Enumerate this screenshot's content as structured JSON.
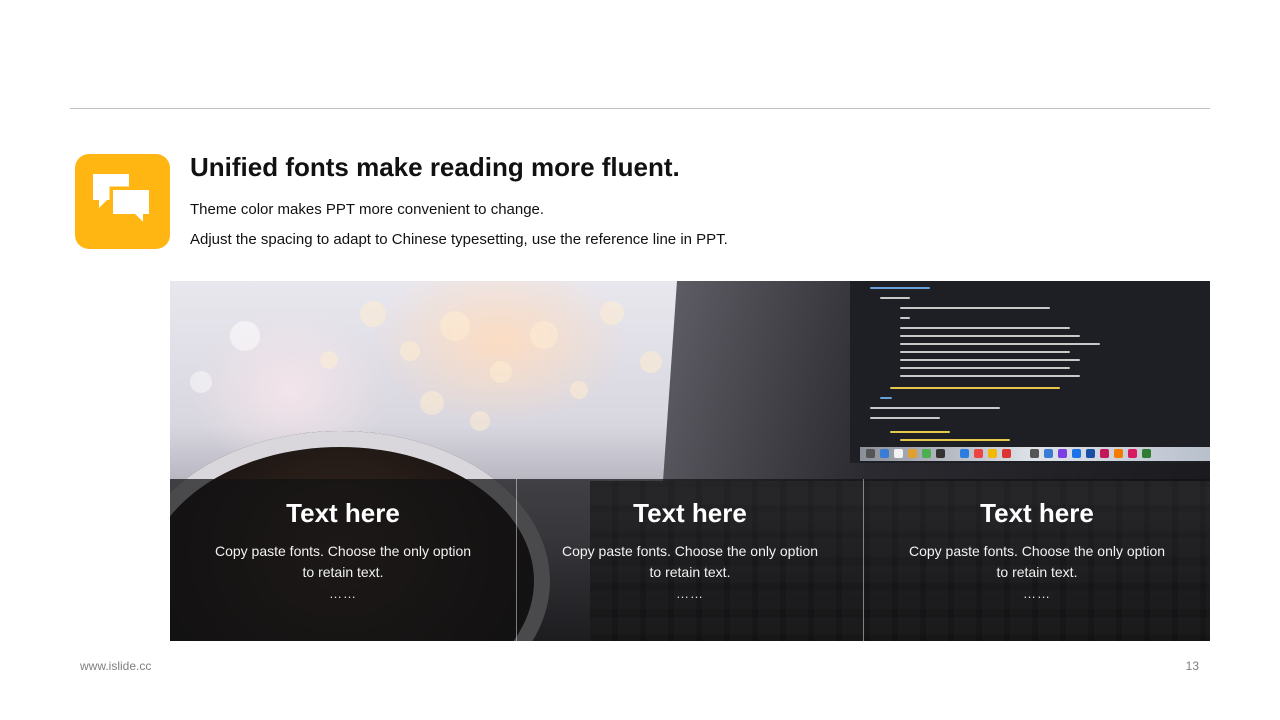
{
  "slide": {
    "heading": "Unified fonts make reading more fluent.",
    "subtitle_1": "Theme color makes PPT more convenient to change.",
    "subtitle_2": "Adjust the spacing to adapt to Chinese typesetting, use the reference line in PPT.",
    "icon": "chat-bubbles-icon",
    "accent_color": "#ffb612"
  },
  "columns": [
    {
      "title": "Text here",
      "body": "Copy paste fonts. Choose the only option to retain text.",
      "dots": "……"
    },
    {
      "title": "Text here",
      "body": "Copy paste fonts. Choose the only option to retain text.",
      "dots": "……"
    },
    {
      "title": "Text here",
      "body": "Copy paste fonts. Choose the only option to retain text.",
      "dots": "……"
    }
  ],
  "footer": {
    "website": "www.islide.cc",
    "page_number": "13"
  }
}
